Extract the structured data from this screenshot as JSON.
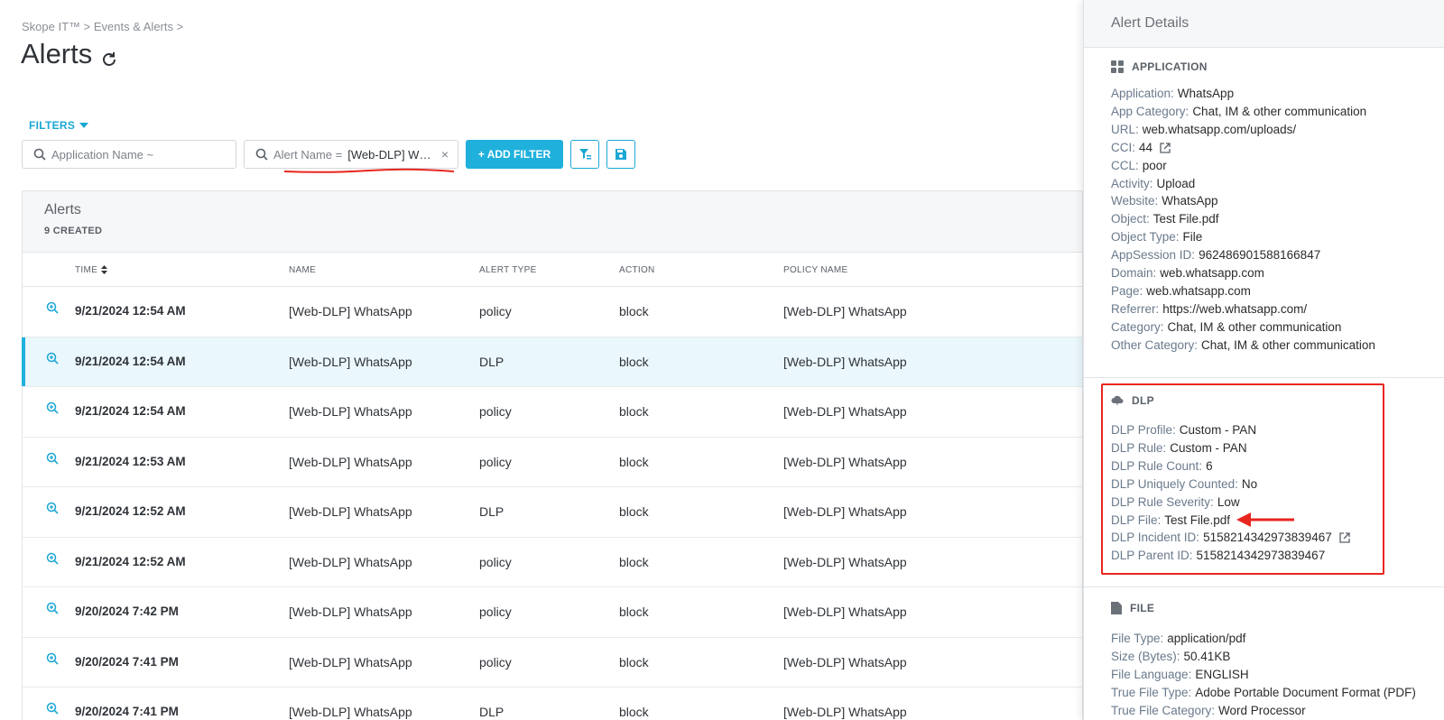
{
  "breadcrumb": "Skope IT™ > Events & Alerts >",
  "page_title": "Alerts",
  "filters_label": "FILTERS",
  "filter_app": {
    "placeholder": "Application Name ~"
  },
  "filter_alert": {
    "label": "Alert Name =",
    "value": "[Web-DLP] WhatsApp",
    "clear": "×"
  },
  "add_filter_label": "+ ADD FILTER",
  "alerts_panel": {
    "title": "Alerts",
    "count": "9 CREATED",
    "columns": {
      "time": "TIME",
      "name": "NAME",
      "alert_type": "ALERT TYPE",
      "action": "ACTION",
      "policy": "POLICY NAME"
    },
    "rows": [
      {
        "time": "9/21/2024 12:54 AM",
        "name": "[Web-DLP] WhatsApp",
        "type": "policy",
        "action": "block",
        "policy": "[Web-DLP] WhatsApp"
      },
      {
        "time": "9/21/2024 12:54 AM",
        "name": "[Web-DLP] WhatsApp",
        "type": "DLP",
        "action": "block",
        "policy": "[Web-DLP] WhatsApp"
      },
      {
        "time": "9/21/2024 12:54 AM",
        "name": "[Web-DLP] WhatsApp",
        "type": "policy",
        "action": "block",
        "policy": "[Web-DLP] WhatsApp"
      },
      {
        "time": "9/21/2024 12:53 AM",
        "name": "[Web-DLP] WhatsApp",
        "type": "policy",
        "action": "block",
        "policy": "[Web-DLP] WhatsApp"
      },
      {
        "time": "9/21/2024 12:52 AM",
        "name": "[Web-DLP] WhatsApp",
        "type": "DLP",
        "action": "block",
        "policy": "[Web-DLP] WhatsApp"
      },
      {
        "time": "9/21/2024 12:52 AM",
        "name": "[Web-DLP] WhatsApp",
        "type": "policy",
        "action": "block",
        "policy": "[Web-DLP] WhatsApp"
      },
      {
        "time": "9/20/2024 7:42 PM",
        "name": "[Web-DLP] WhatsApp",
        "type": "policy",
        "action": "block",
        "policy": "[Web-DLP] WhatsApp"
      },
      {
        "time": "9/20/2024 7:41 PM",
        "name": "[Web-DLP] WhatsApp",
        "type": "policy",
        "action": "block",
        "policy": "[Web-DLP] WhatsApp"
      },
      {
        "time": "9/20/2024 7:41 PM",
        "name": "[Web-DLP] WhatsApp",
        "type": "DLP",
        "action": "block",
        "policy": "[Web-DLP] WhatsApp"
      }
    ]
  },
  "details": {
    "title": "Alert Details",
    "application": {
      "title": "APPLICATION",
      "fields": [
        {
          "k": "Application:",
          "v": "WhatsApp"
        },
        {
          "k": "App Category:",
          "v": "Chat, IM & other communication"
        },
        {
          "k": "URL:",
          "v": "web.whatsapp.com/uploads/"
        },
        {
          "k": "CCI:",
          "v": "44"
        },
        {
          "k": "CCL:",
          "v": "poor"
        },
        {
          "k": "Activity:",
          "v": "Upload"
        },
        {
          "k": "Website:",
          "v": "WhatsApp"
        },
        {
          "k": "Object:",
          "v": "Test File.pdf"
        },
        {
          "k": "Object Type:",
          "v": "File"
        },
        {
          "k": "AppSession ID:",
          "v": "962486901588166847"
        },
        {
          "k": "Domain:",
          "v": "web.whatsapp.com"
        },
        {
          "k": "Page:",
          "v": "web.whatsapp.com"
        },
        {
          "k": "Referrer:",
          "v": "https://web.whatsapp.com/"
        },
        {
          "k": "Category:",
          "v": "Chat, IM & other communication"
        },
        {
          "k": "Other Category:",
          "v": "Chat, IM & other communication"
        }
      ]
    },
    "dlp": {
      "title": "DLP",
      "fields": [
        {
          "k": "DLP Profile:",
          "v": "Custom - PAN"
        },
        {
          "k": "DLP Rule:",
          "v": "Custom - PAN"
        },
        {
          "k": "DLP Rule Count:",
          "v": "6"
        },
        {
          "k": "DLP Uniquely Counted:",
          "v": "No"
        },
        {
          "k": "DLP Rule Severity:",
          "v": "Low"
        },
        {
          "k": "DLP File:",
          "v": "Test File.pdf"
        },
        {
          "k": "DLP Incident ID:",
          "v": "5158214342973839467"
        },
        {
          "k": "DLP Parent ID:",
          "v": "5158214342973839467"
        }
      ]
    },
    "file": {
      "title": "FILE",
      "fields": [
        {
          "k": "File Type:",
          "v": "application/pdf"
        },
        {
          "k": "Size (Bytes):",
          "v": "50.41KB"
        },
        {
          "k": "File Language:",
          "v": "ENGLISH"
        },
        {
          "k": "True File Type:",
          "v": "Adobe Portable Document Format (PDF)"
        },
        {
          "k": "True File Category:",
          "v": "Word Processor"
        }
      ]
    }
  },
  "colors": {
    "accent": "#1fb1dc",
    "annotation_red": "#e8261f",
    "selected_row": "#eaf7fc"
  }
}
